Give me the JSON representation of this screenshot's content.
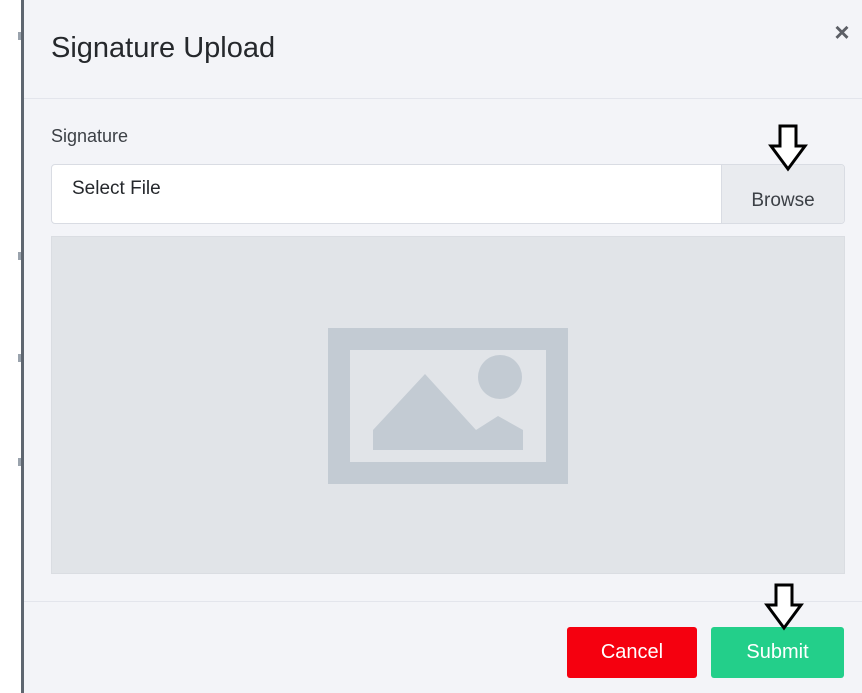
{
  "dialog": {
    "title": "Signature Upload",
    "close_glyph": "×"
  },
  "form": {
    "signature_label": "Signature",
    "file_input_text": "Select File",
    "browse_label": "Browse",
    "preview_icon": "image-placeholder-icon"
  },
  "footer": {
    "cancel_label": "Cancel",
    "submit_label": "Submit"
  },
  "annotations": {
    "arrow_icon": "down-arrow-icon"
  },
  "colors": {
    "cancel": "#f5000f",
    "submit": "#23cf8a",
    "modal_background": "#f3f4f8",
    "preview_background": "#e1e4e8",
    "placeholder_icon": "#c3cbd3"
  }
}
